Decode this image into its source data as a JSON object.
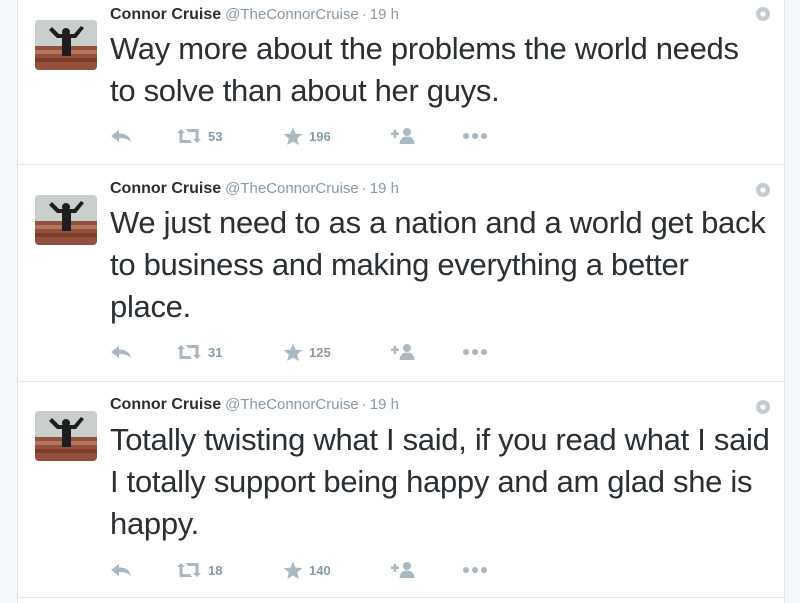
{
  "colors": {
    "text": "#292f33",
    "muted": "#8899a6",
    "divider": "#e1e8ed"
  },
  "icons": {
    "reply": "reply-icon",
    "retweet": "retweet-icon",
    "favorite": "star-icon",
    "follow": "follow-user-icon",
    "more": "more-dots-icon",
    "menu": "settings-gear-icon"
  },
  "tweets": [
    {
      "name": "Connor Cruise",
      "handle": "@TheConnorCruise",
      "separator": "·",
      "time": "19 h",
      "text": "Way more about the problems the world needs to solve than about her guys.",
      "retweets": "53",
      "favorites": "196"
    },
    {
      "name": "Connor Cruise",
      "handle": "@TheConnorCruise",
      "separator": "·",
      "time": "19 h",
      "text": "We just need to as a nation and a world get back to business and making everything a better place.",
      "retweets": "31",
      "favorites": "125"
    },
    {
      "name": "Connor Cruise",
      "handle": "@TheConnorCruise",
      "separator": "·",
      "time": "19 h",
      "text": "Totally twisting what I said, if you read what I said I totally support being happy and am glad she is happy.",
      "retweets": "18",
      "favorites": "140"
    }
  ]
}
